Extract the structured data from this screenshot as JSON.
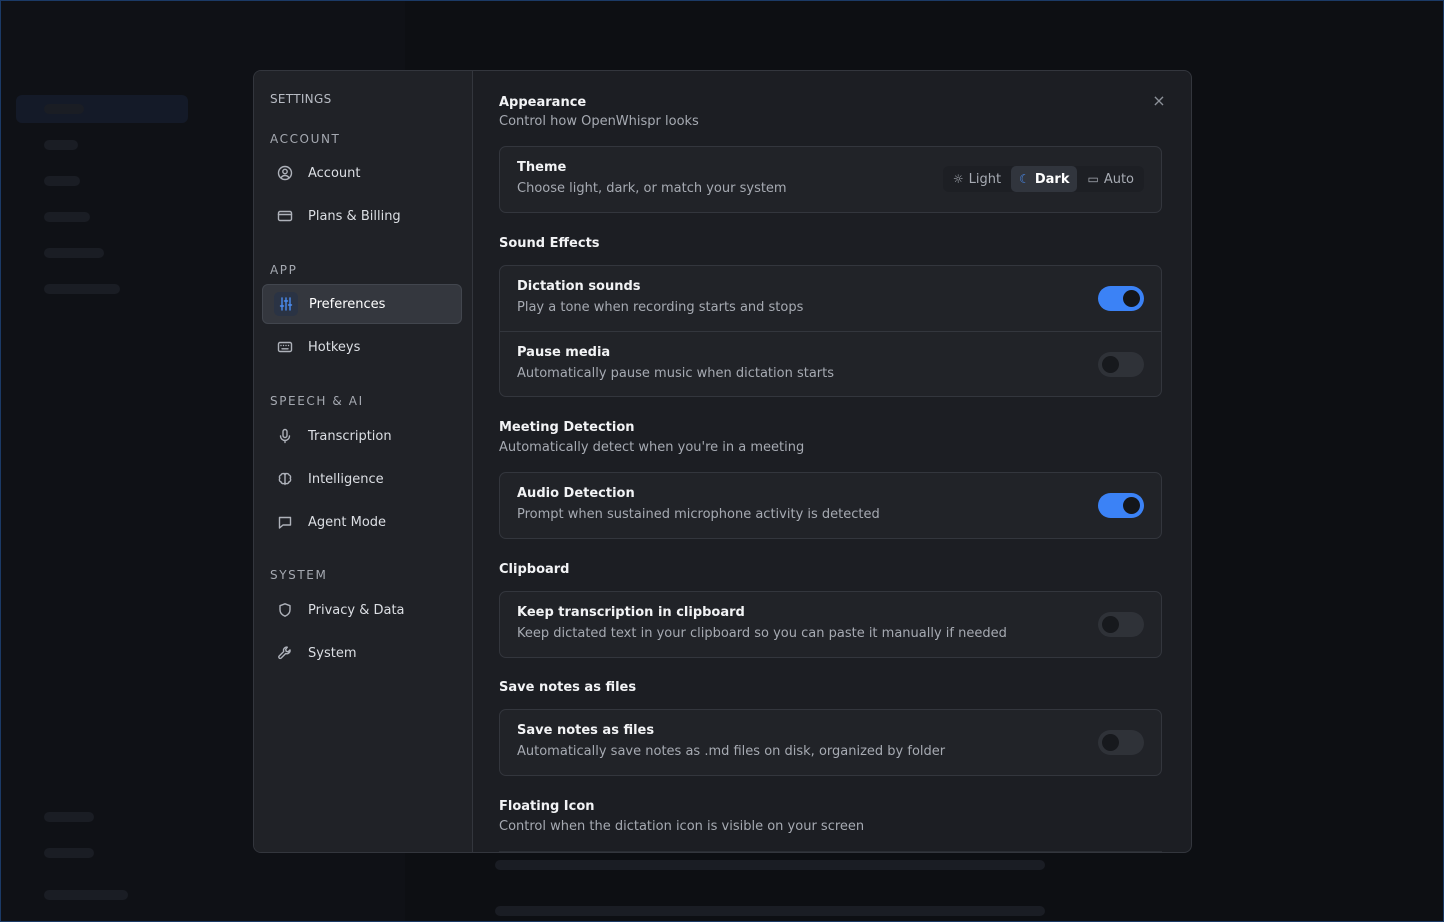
{
  "sidebar": {
    "title": "SETTINGS",
    "groups": {
      "account": "ACCOUNT",
      "app": "APP",
      "speech": "SPEECH & AI",
      "system": "SYSTEM"
    },
    "items": [
      {
        "label": "Account",
        "icon": "user-circle-icon"
      },
      {
        "label": "Plans & Billing",
        "icon": "credit-card-icon"
      },
      {
        "label": "Preferences",
        "icon": "sliders-icon",
        "active": true
      },
      {
        "label": "Hotkeys",
        "icon": "keyboard-icon"
      },
      {
        "label": "Transcription",
        "icon": "microphone-icon"
      },
      {
        "label": "Intelligence",
        "icon": "brain-icon"
      },
      {
        "label": "Agent Mode",
        "icon": "chat-bubble-icon"
      },
      {
        "label": "Privacy & Data",
        "icon": "shield-icon"
      },
      {
        "label": "System",
        "icon": "wrench-icon"
      }
    ]
  },
  "content": {
    "close_label": "×",
    "appearance": {
      "title": "Appearance",
      "subtitle": "Control how OpenWhispr looks",
      "theme": {
        "title": "Theme",
        "description": "Choose light, dark, or match your system",
        "options": [
          "Light",
          "Dark",
          "Auto"
        ],
        "selected": "Dark"
      }
    },
    "sound_effects": {
      "title": "Sound Effects",
      "dictation_sounds": {
        "title": "Dictation sounds",
        "description": "Play a tone when recording starts and stops",
        "on": true
      },
      "pause_media": {
        "title": "Pause media",
        "description": "Automatically pause music when dictation starts",
        "on": false
      }
    },
    "meeting_detection": {
      "title": "Meeting Detection",
      "subtitle": "Automatically detect when you're in a meeting",
      "audio_detection": {
        "title": "Audio Detection",
        "description": "Prompt when sustained microphone activity is detected",
        "on": true
      }
    },
    "clipboard": {
      "title": "Clipboard",
      "keep": {
        "title": "Keep transcription in clipboard",
        "description": "Keep dictated text in your clipboard so you can paste it manually if needed",
        "on": false
      }
    },
    "save_notes": {
      "title": "Save notes as files",
      "item": {
        "title": "Save notes as files",
        "description": "Automatically save notes as .md files on disk, organized by folder",
        "on": false
      }
    },
    "floating_icon": {
      "title": "Floating Icon",
      "subtitle": "Control when the dictation icon is visible on your screen"
    }
  },
  "colors": {
    "accent": "#3b82f6",
    "modal_bg": "#1c1e23",
    "sidebar_bg": "#202227"
  }
}
